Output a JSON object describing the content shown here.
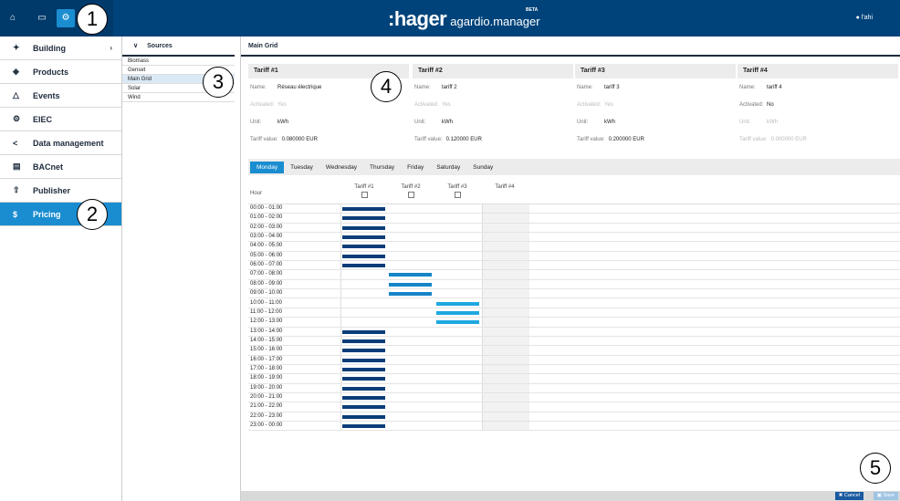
{
  "header": {
    "logo_brand": ":hager",
    "logo_product": "agardio.manager",
    "beta": "BETA",
    "user": "l'ahi",
    "nav_icons": [
      "home-icon",
      "monitor-icon",
      "gears-icon"
    ]
  },
  "sidebar": {
    "items": [
      {
        "label": "Building",
        "icon": "wrench-icon",
        "has_chevron": true
      },
      {
        "label": "Products",
        "icon": "cube-icon"
      },
      {
        "label": "Events",
        "icon": "bell-icon"
      },
      {
        "label": "EIEC",
        "icon": "gears-icon"
      },
      {
        "label": "Data management",
        "icon": "share-icon"
      },
      {
        "label": "BACnet",
        "icon": "server-icon"
      },
      {
        "label": "Publisher",
        "icon": "upload-icon"
      },
      {
        "label": "Pricing",
        "icon": "dollar-icon",
        "active": true
      }
    ],
    "chevron": "›"
  },
  "sources": {
    "title": "Sources",
    "chevron": "∨",
    "items": [
      "Biomass",
      "Genset",
      "Main Grid",
      "Solar",
      "Wind"
    ],
    "selected": "Main Grid"
  },
  "main": {
    "title": "Main Grid",
    "tariffs": [
      {
        "title": "Tariff #1",
        "name_label": "Name:",
        "name": "Réseau électrique",
        "activated_label": "Activated:",
        "activated": "Yes",
        "unit_label": "Unit:",
        "unit": "kWh",
        "value_label": "Tariff value:",
        "value": "0.080000 EUR",
        "dim_activated": true,
        "dim_unit": false,
        "dim_value": false
      },
      {
        "title": "Tariff #2",
        "name_label": "Name:",
        "name": "tariff 2",
        "activated_label": "Activated:",
        "activated": "Yes",
        "unit_label": "Unit:",
        "unit": "kWh",
        "value_label": "Tariff value:",
        "value": "0.120000 EUR",
        "dim_activated": true,
        "dim_unit": false,
        "dim_value": false
      },
      {
        "title": "Tariff #3",
        "name_label": "Name:",
        "name": "tariff 3",
        "activated_label": "Activated:",
        "activated": "Yes",
        "unit_label": "Unit:",
        "unit": "kWh",
        "value_label": "Tariff value:",
        "value": "0.200000 EUR",
        "dim_activated": true,
        "dim_unit": false,
        "dim_value": false
      },
      {
        "title": "Tariff #4",
        "name_label": "Name:",
        "name": "tariff 4",
        "activated_label": "Activated:",
        "activated": "No",
        "unit_label": "Unit:",
        "unit": "kWh",
        "value_label": "Tariff value:",
        "value": "0.000000 EUR",
        "dim_activated": false,
        "dim_unit": true,
        "dim_value": true
      }
    ],
    "days": [
      "Monday",
      "Tuesday",
      "Wednesday",
      "Thursday",
      "Friday",
      "Saturday",
      "Sunday"
    ],
    "active_day": "Monday",
    "grid": {
      "hour_label": "Hour",
      "columns": [
        "Tariff #1",
        "Tariff #2",
        "Tariff #3",
        "Tariff #4"
      ],
      "hours": [
        "00:00 - 01:00",
        "01:00 - 02:00",
        "02:00 - 03:00",
        "03:00 - 04:00",
        "04:00 - 05:00",
        "05:00 - 06:00",
        "06:00 - 07:00",
        "07:00 - 08:00",
        "08:00 - 09:00",
        "09:00 - 10:00",
        "10:00 - 11:00",
        "11:00 - 12:00",
        "12:00 - 13:00",
        "13:00 - 14:00",
        "14:00 - 15:00",
        "15:00 - 16:00",
        "16:00 - 17:00",
        "17:00 - 18:00",
        "18:00 - 19:00",
        "19:00 - 20:00",
        "20:00 - 21:00",
        "21:00 - 22:00",
        "22:00 - 23:00",
        "23:00 - 00:00"
      ],
      "assignment": [
        1,
        1,
        1,
        1,
        1,
        1,
        1,
        2,
        2,
        2,
        3,
        3,
        3,
        1,
        1,
        1,
        1,
        1,
        1,
        1,
        1,
        1,
        1,
        1
      ]
    },
    "colors": {
      "tariff1": "#0b3d78",
      "tariff2": "#1584c8",
      "tariff3": "#1ea8e0",
      "accent": "#1a8dd0"
    }
  },
  "footer": {
    "cancel": "Cancel",
    "save": "Save"
  },
  "callouts": [
    "1",
    "2",
    "3",
    "4",
    "5"
  ]
}
